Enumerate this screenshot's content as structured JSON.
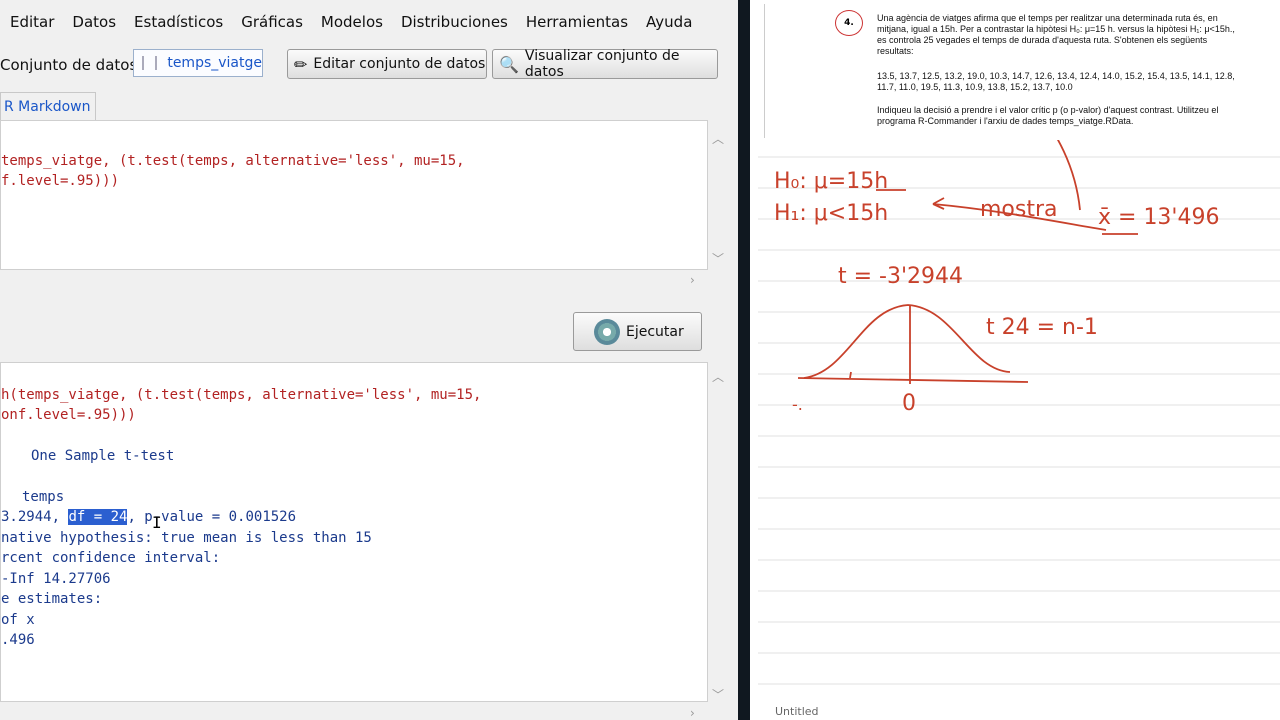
{
  "menu": [
    "Editar",
    "Datos",
    "Estadísticos",
    "Gráficas",
    "Modelos",
    "Distribuciones",
    "Herramientas",
    "Ayuda"
  ],
  "dataset": {
    "label": "Conjunto de datos:",
    "name": "temps_viatge",
    "edit_button": "Editar conjunto de datos",
    "view_button": "Visualizar conjunto de datos"
  },
  "tab_label": "R Markdown",
  "script_lines": [
    "temps_viatge, (t.test(temps, alternative='less', mu=15,",
    "f.level=.95)))"
  ],
  "run_button": "Ejecutar",
  "output": {
    "cmd1": "h(temps_viatge, (t.test(temps, alternative='less', mu=15,",
    "cmd2": "onf.level=.95)))",
    "title": "One Sample t-test",
    "data_line": "temps",
    "t_part": "3.2944, ",
    "df_part": "df = 24",
    "p_part": ", p-value = 0.001526",
    "alt": "native hypothesis: true mean is less than 15",
    "ci": "rcent confidence interval:",
    "ci_vals": "-Inf 14.27706",
    "est": "e estimates:",
    "est_name": "of x",
    "est_val": ".496"
  },
  "problem": {
    "number": "4.",
    "line1": "Una agència de viatges afirma que el temps per realitzar una determinada ruta és, en",
    "line2": "mitjana, igual a 15h. Per a contrastar la hipòtesi H₀: μ=15 h. versus la hipòtesi H₁: μ<15h.,",
    "line3": "es controla 25 vegades el temps de durada d'aquesta ruta. S'obtenen els següents",
    "line4": "resultats:",
    "data1": "13.5, 13.7, 12.5, 13.2, 19.0, 10.3, 14.7, 12.6, 13.4, 12.4, 14.0, 15.2, 15.4, 13.5, 14.1, 12.8,",
    "data2": "11.7, 11.0, 19.5, 11.3, 10.9, 13.8, 15.2, 13.7, 10.0",
    "instr1": "Indiqueu la decisió a prendre i el valor crític p (o p-valor) d'aquest contrast. Utilitzeu el",
    "instr2": "programa R-Commander i l'arxiu de dades  temps_viatge.RData."
  },
  "handwriting": {
    "h0": "H₀: μ=15h",
    "h1": "H₁: μ<15h",
    "mostra": "mostra",
    "xbar": "x̄ = 13'496",
    "t": "t = -3'2944",
    "df": "t 24 = n-1",
    "zero": "0",
    "minus": "-."
  },
  "footer": "Untitled",
  "colors": {
    "ink": "#c8412b",
    "selection": "#2b5fd0",
    "code_red": "#b22222",
    "code_blue": "#1b3a8c"
  }
}
